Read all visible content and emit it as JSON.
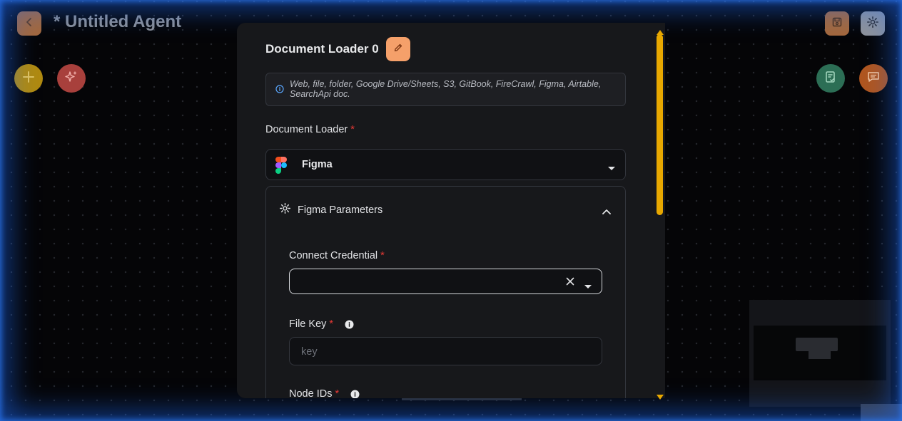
{
  "app": {
    "title": "* Untitled Agent"
  },
  "dialog": {
    "title": "Document Loader 0",
    "info_text": "Web, file, folder, Google Drive/Sheets, S3, GitBook, FireCrawl, Figma, Airtable, SearchApi doc.",
    "document_loader_label": "Document Loader",
    "document_loader_value": "Figma",
    "required_mark": "*",
    "params_title": "Figma Parameters",
    "connect_credential_label": "Connect Credential",
    "file_key_label": "File Key",
    "file_key_placeholder": "key",
    "node_ids_label": "Node IDs"
  },
  "colors": {
    "accent": "#f5a06a",
    "scrollbar": "#e8a800",
    "required": "#e53935",
    "glow": "#1e6eff"
  }
}
